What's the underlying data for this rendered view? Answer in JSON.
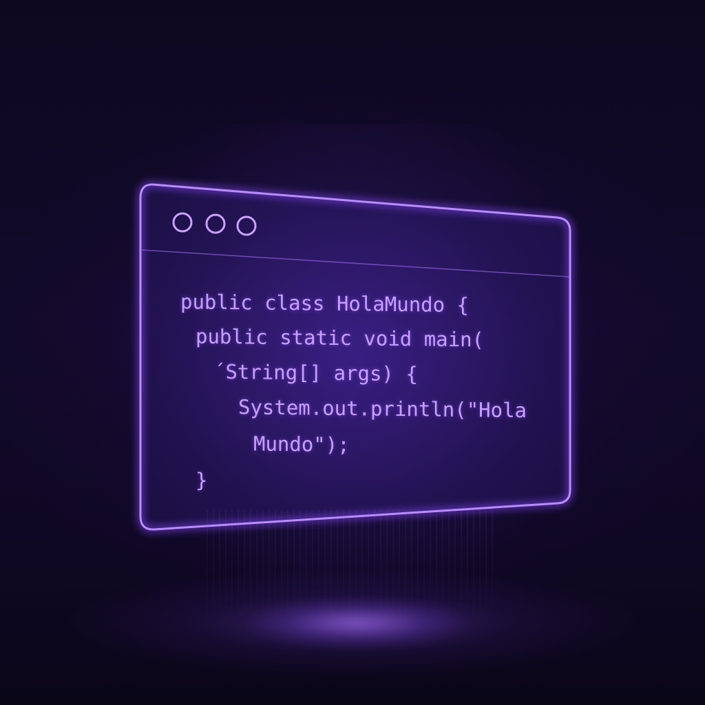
{
  "window": {
    "controls": [
      "window-dot-1",
      "window-dot-2",
      "window-dot-3"
    ]
  },
  "code": {
    "lines": [
      "public class HolaMundo {",
      "public static void main(",
      "´String[] args) {",
      "System.out.println(\"Hola",
      "Mundo\");",
      "}"
    ]
  },
  "colors": {
    "background": "#0b0719",
    "neon_frame": "#b98cff",
    "neon_glow": "#8a4dff",
    "code_text": "#c7a0ff"
  }
}
